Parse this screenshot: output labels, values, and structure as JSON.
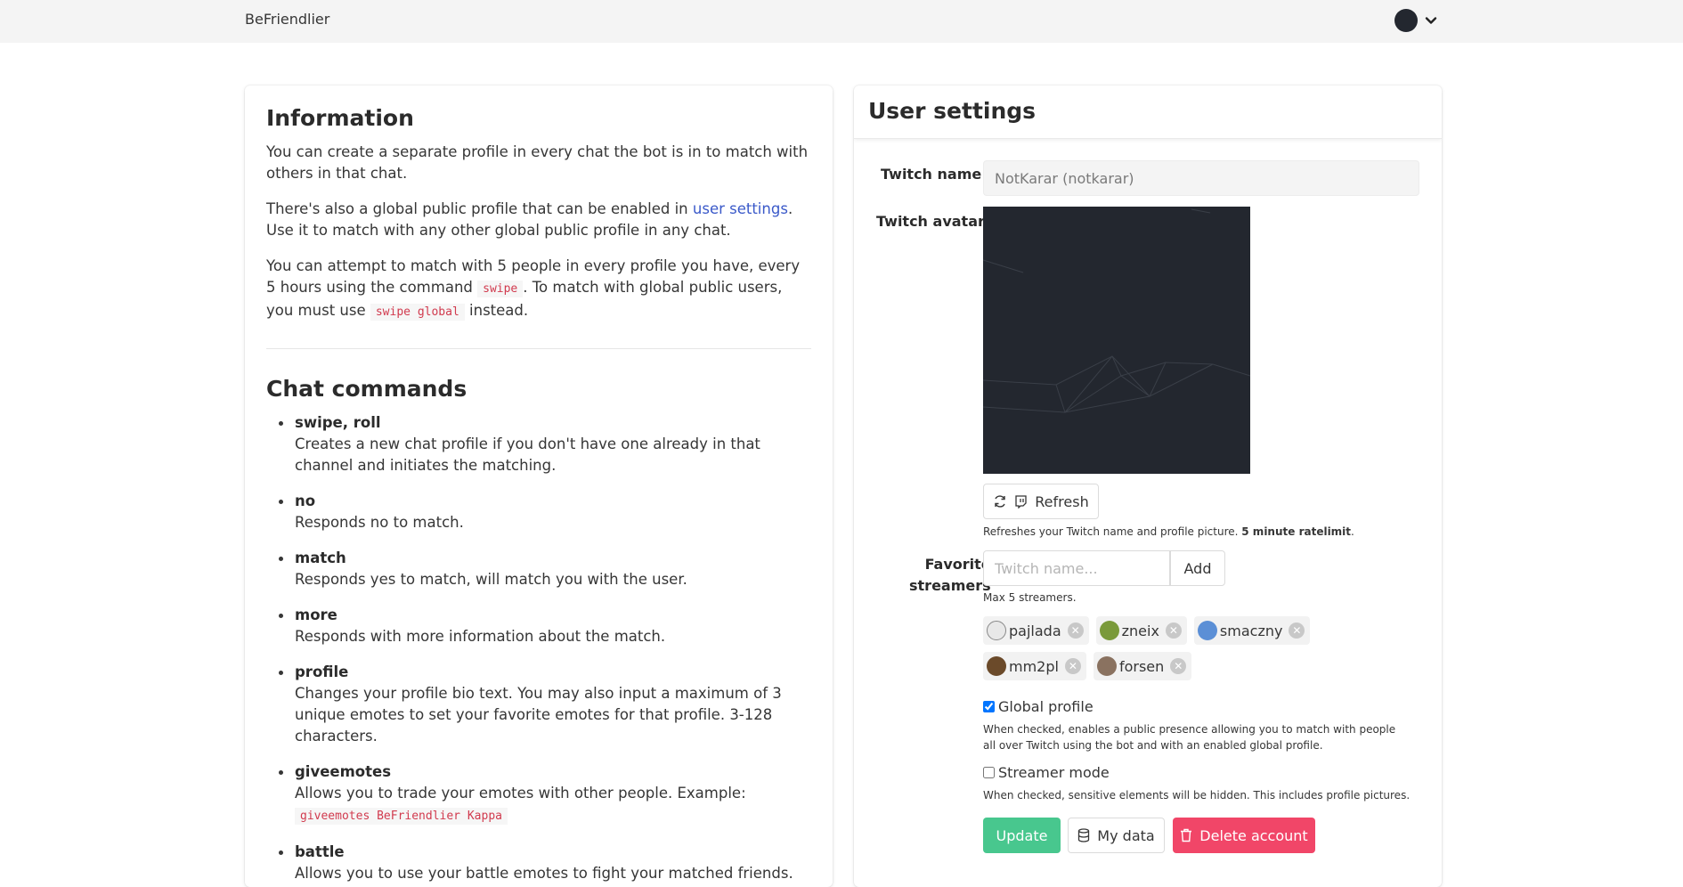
{
  "navbar": {
    "brand": "BeFriendlier"
  },
  "info": {
    "title": "Information",
    "p1": "You can create a separate profile in every chat the bot is in to match with others in that chat.",
    "p2_before": "There's also a global public profile that can be enabled in ",
    "p2_link": "user settings",
    "p2_after": ". Use it to match with any other global public profile in any chat.",
    "p3_a": "You can attempt to match with 5 people in every profile you have, every 5 hours using the command ",
    "p3_code1": "swipe",
    "p3_b": ". To match with global public users, you must use ",
    "p3_code2": "swipe global",
    "p3_c": " instead."
  },
  "commands": {
    "title": "Chat commands",
    "items": [
      {
        "name": "swipe, roll",
        "desc": "Creates a new chat profile if you don't have one already in that channel and initiates the matching."
      },
      {
        "name": "no",
        "desc": "Responds no to match."
      },
      {
        "name": "match",
        "desc": "Responds yes to match, will match you with the user."
      },
      {
        "name": "more",
        "desc": "Responds with more information about the match."
      },
      {
        "name": "profile",
        "desc": "Changes your profile bio text. You may also input a maximum of 3 unique emotes to set your favorite emotes for that profile. 3-128 characters."
      },
      {
        "name": "giveemotes",
        "desc": "Allows you to trade your emotes with other people. Example: ",
        "code": "giveemotes BeFriendlier Kappa"
      },
      {
        "name": "battle",
        "desc": "Allows you to use your battle emotes to fight your matched friends. You must"
      }
    ]
  },
  "settings": {
    "title": "User settings",
    "twitch_name_label": "Twitch name",
    "twitch_name_value": "NotKarar (notkarar)",
    "twitch_avatar_label": "Twitch avatar",
    "refresh_label": "Refresh",
    "refresh_help": "Refreshes your Twitch name and profile picture. ",
    "refresh_help_bold": "5 minute ratelimit",
    "refresh_help_end": ".",
    "favorite_label_1": "Favorite",
    "favorite_label_2": "streamers",
    "streamer_placeholder": "Twitch name...",
    "add_label": "Add",
    "max_help": "Max 5 streamers.",
    "streamers": [
      {
        "name": "pajlada",
        "color": "#e8e8e8"
      },
      {
        "name": "zneix",
        "color": "#7a9a3a"
      },
      {
        "name": "smaczny",
        "color": "#5b8fd6"
      },
      {
        "name": "mm2pl",
        "color": "#6b4a2a"
      },
      {
        "name": "forsen",
        "color": "#8a7260"
      }
    ],
    "global_profile_label": "Global profile",
    "global_profile_checked": true,
    "global_profile_help": "When checked, enables a public presence allowing you to match with people all over Twitch using the bot and with an enabled global profile.",
    "streamer_mode_label": "Streamer mode",
    "streamer_mode_checked": false,
    "streamer_mode_help": "When checked, sensitive elements will be hidden. This includes profile pictures.",
    "update_label": "Update",
    "mydata_label": "My data",
    "delete_label": "Delete account"
  }
}
